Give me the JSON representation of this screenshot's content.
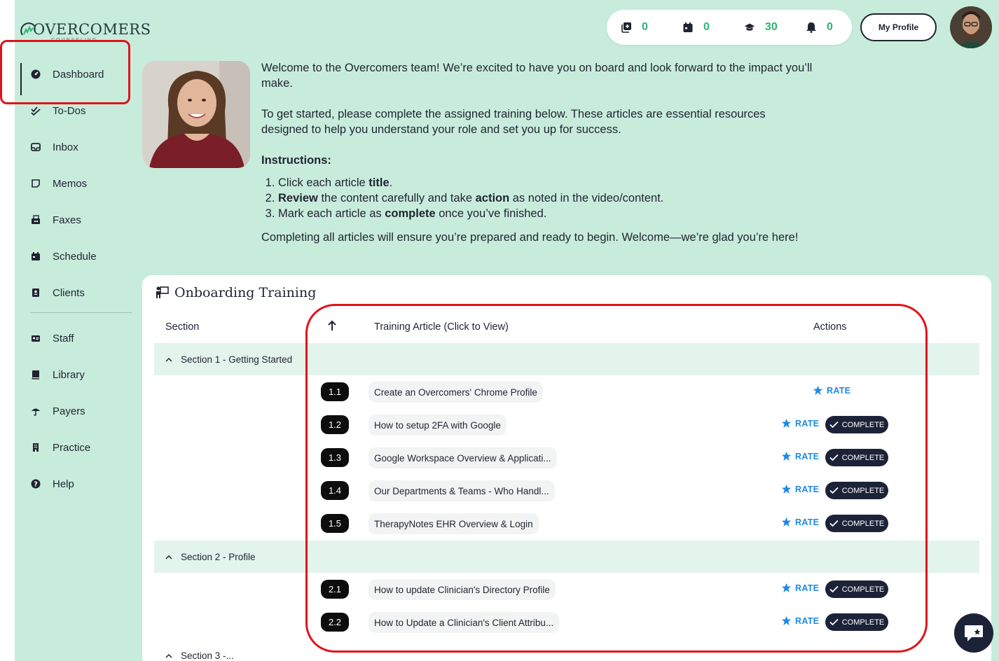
{
  "brand": {
    "name": "OVERCOMERS",
    "subtitle": "COUNSELING"
  },
  "sidebar": {
    "items": [
      {
        "label": "Dashboard",
        "icon": "dashboard-icon",
        "active": true
      },
      {
        "label": "To-Dos",
        "icon": "double-check-icon"
      },
      {
        "label": "Inbox",
        "icon": "inbox-icon"
      },
      {
        "label": "Memos",
        "icon": "note-icon"
      },
      {
        "label": "Faxes",
        "icon": "fax-icon"
      },
      {
        "label": "Schedule",
        "icon": "calendar-icon"
      },
      {
        "label": "Clients",
        "icon": "address-book-icon"
      },
      {
        "label": "Staff",
        "icon": "id-card-icon"
      },
      {
        "label": "Library",
        "icon": "book-icon"
      },
      {
        "label": "Payers",
        "icon": "umbrella-icon"
      },
      {
        "label": "Practice",
        "icon": "building-icon"
      },
      {
        "label": "Help",
        "icon": "question-icon"
      }
    ]
  },
  "topbar": {
    "counters": [
      {
        "icon": "add-stack-icon",
        "count": "0"
      },
      {
        "icon": "calendar-icon",
        "count": "0"
      },
      {
        "icon": "graduation-cap-icon",
        "count": "30"
      },
      {
        "icon": "bell-icon",
        "count": "0"
      }
    ],
    "profile_label": "My Profile"
  },
  "welcome": {
    "p1": "Welcome to the Overcomers team! We’re excited to have you on board and look forward to the impact you’ll make.",
    "p2": "To get started, please complete the assigned training below.  These articles are essential resources designed to help you understand your role and set you up for success.",
    "instructions_title": "Instructions:",
    "step1_a": "Click each article ",
    "step1_b": "title",
    "step1_c": ".",
    "step2_a": "Review",
    "step2_b": " the content carefully and take ",
    "step2_c": "action",
    "step2_d": " as noted in the video/content.",
    "step3_a": "Mark each article as ",
    "step3_b": "complete",
    "step3_c": " once you’ve finished.",
    "p3": "Completing all articles will ensure you’re prepared and ready to begin. Welcome—we’re glad you’re here!"
  },
  "training": {
    "title": "Onboarding Training",
    "col_section": "Section",
    "col_article": "Training Article (Click to View)",
    "col_actions": "Actions",
    "rate_label": "RATE",
    "complete_label": "COMPLETE",
    "sections": [
      {
        "name": "Section 1 - Getting Started",
        "articles": [
          {
            "num": "1.1",
            "title": "Create an Overcomers' Chrome Profile",
            "complete_btn": false
          },
          {
            "num": "1.2",
            "title": "How to setup 2FA with Google",
            "complete_btn": true
          },
          {
            "num": "1.3",
            "title": "Google Workspace Overview & Applicati...",
            "complete_btn": true
          },
          {
            "num": "1.4",
            "title": "Our Departments & Teams - Who Handl...",
            "complete_btn": true
          },
          {
            "num": "1.5",
            "title": "TherapyNotes EHR Overview & Login",
            "complete_btn": true
          }
        ]
      },
      {
        "name": "Section 2 - Profile",
        "articles": [
          {
            "num": "2.1",
            "title": "How to update Clinician's Directory Profile",
            "complete_btn": true
          },
          {
            "num": "2.2",
            "title": "How to Update a Clinician's Client Attribu...",
            "complete_btn": true
          }
        ]
      },
      {
        "name": "Section 3 -...",
        "articles": []
      }
    ]
  },
  "colors": {
    "background": "#c8ecdc",
    "accent_green": "#2bb673",
    "rate_blue": "#1e88e5",
    "dark": "#1c2338",
    "highlight_red": "#e0141b"
  }
}
